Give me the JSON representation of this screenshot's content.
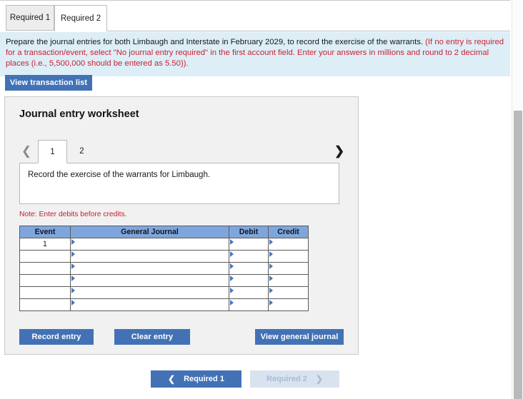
{
  "required_tabs": [
    {
      "label": "Required 1",
      "active": false
    },
    {
      "label": "Required 2",
      "active": true
    }
  ],
  "instruction": {
    "main": "Prepare the journal entries for both Limbaugh and Interstate in February 2029, to record the exercise of the warrants.",
    "hint": "(If no entry is required for a transaction/event, select \"No journal entry required\" in the first account field. Enter your answers in millions and round to 2 decimal places (i.e., 5,500,000 should be entered as 5.50))."
  },
  "toolbar": {
    "view_transaction_list": "View transaction list"
  },
  "worksheet": {
    "title": "Journal entry worksheet",
    "prev_icon": "chevron-left-icon",
    "next_icon": "chevron-right-icon",
    "pages": [
      {
        "label": "1",
        "active": true
      },
      {
        "label": "2",
        "active": false
      }
    ],
    "description": "Record the exercise of the warrants for Limbaugh.",
    "note": "Note: Enter debits before credits."
  },
  "journal_table": {
    "headers": [
      "Event",
      "General Journal",
      "Debit",
      "Credit"
    ],
    "rows": [
      {
        "event": "1",
        "general_journal": "",
        "debit": "",
        "credit": ""
      },
      {
        "event": "",
        "general_journal": "",
        "debit": "",
        "credit": ""
      },
      {
        "event": "",
        "general_journal": "",
        "debit": "",
        "credit": ""
      },
      {
        "event": "",
        "general_journal": "",
        "debit": "",
        "credit": ""
      },
      {
        "event": "",
        "general_journal": "",
        "debit": "",
        "credit": ""
      },
      {
        "event": "",
        "general_journal": "",
        "debit": "",
        "credit": ""
      }
    ]
  },
  "panel_actions": {
    "record_entry": "Record entry",
    "clear_entry": "Clear entry",
    "view_general_journal": "View general journal"
  },
  "bottom_nav": {
    "prev_label": "Required 1",
    "prev_icon": "chevron-left-icon",
    "next_label": "Required 2",
    "next_icon": "chevron-right-icon",
    "next_disabled": true
  },
  "colors": {
    "accent_blue": "#4272b5",
    "table_header_blue": "#7fa6dc",
    "banner_blue": "#ddeef7",
    "alert_red": "#cc2131",
    "panel_gray": "#f1f1f1",
    "disabled_blue": "#d9e3ef"
  }
}
